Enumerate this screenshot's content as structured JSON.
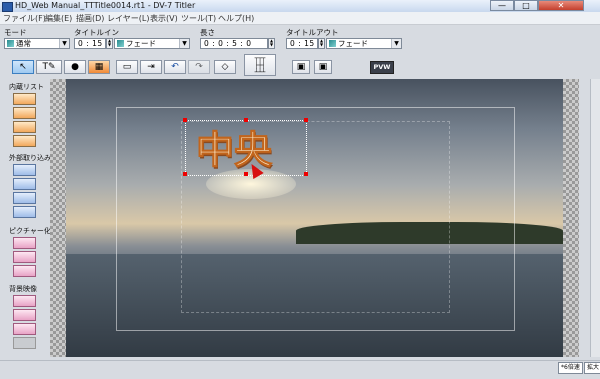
{
  "window": {
    "title": "HD_Web Manual_TTTitle0014.rt1 - DV-7 Titler",
    "close_label": "✕",
    "min_label": "—",
    "max_label": "□"
  },
  "menu": [
    {
      "label": "ファイル(F)"
    },
    {
      "label": "編集(E)"
    },
    {
      "label": "描画(D)"
    },
    {
      "label": "レイヤー(L)"
    },
    {
      "label": "表示(V)"
    },
    {
      "label": "ツール(T)"
    },
    {
      "label": "ヘルプ(H)"
    }
  ],
  "controls": {
    "mode_label": "モード",
    "mode_value": "通常",
    "title_in_label": "タイトルイン",
    "title_in_time": "0 : 15",
    "title_in_effect": "フェード",
    "duration_label": "長さ",
    "duration_time": "0 : 0 : 5 : 0",
    "title_out_label": "タイトルアウト",
    "title_out_time": "0 : 15",
    "title_out_effect": "フェード",
    "pvw_label": "PVW"
  },
  "sidebar": {
    "sections": [
      {
        "title": "内蔵リスト"
      },
      {
        "title": "外部取り込み"
      },
      {
        "title": "ピクチャー化"
      },
      {
        "title": "背景映像"
      }
    ]
  },
  "canvas": {
    "title_text": "中央"
  },
  "status": {
    "button1": "*6倍速",
    "button2": "拡大"
  },
  "colors": {
    "accent": "#3c7fc1",
    "title_fill": "#fbe7c5",
    "title_stroke": "#c2651c",
    "handle": "#e00000"
  }
}
